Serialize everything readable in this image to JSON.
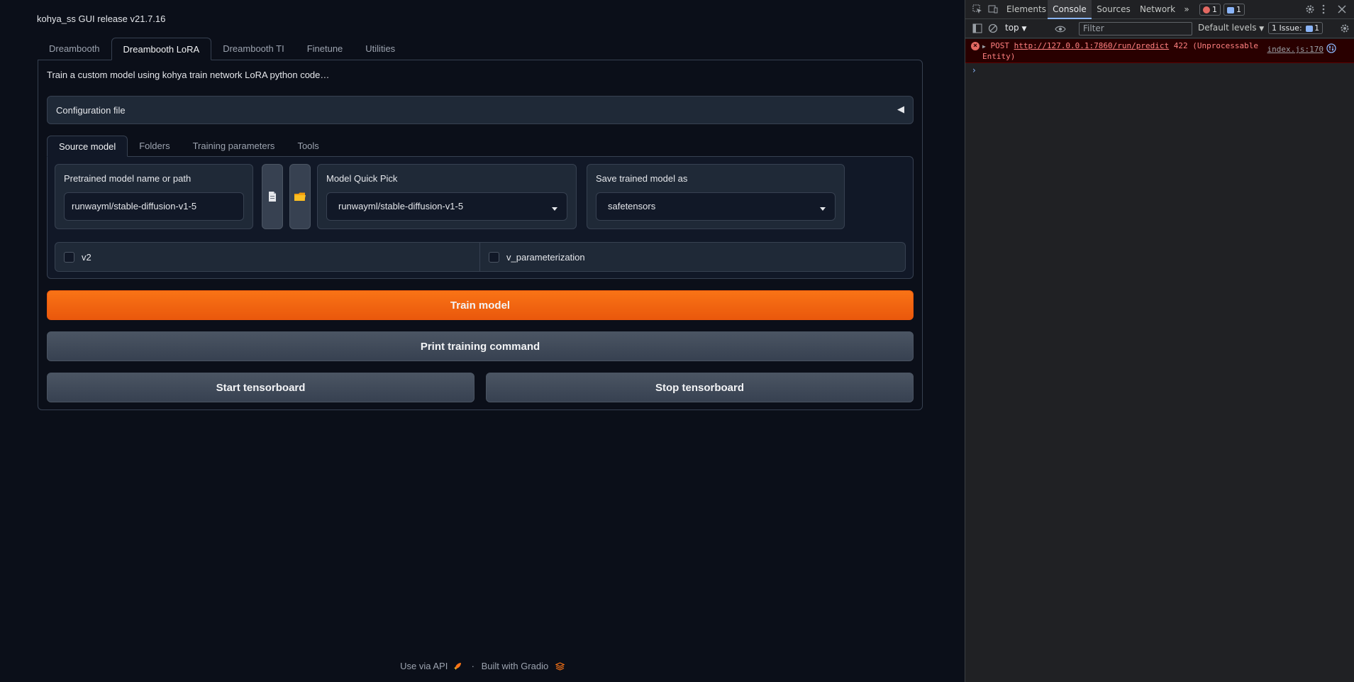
{
  "app": {
    "title": "kohya_ss GUI release v21.7.16",
    "tabs": [
      {
        "label": "Dreambooth"
      },
      {
        "label": "Dreambooth LoRA"
      },
      {
        "label": "Dreambooth TI"
      },
      {
        "label": "Finetune"
      },
      {
        "label": "Utilities"
      }
    ],
    "active_tab": "Dreambooth LoRA",
    "description": "Train a custom model using kohya train network LoRA python code…",
    "config_accordion": {
      "label": "Configuration file",
      "caret": "◀"
    },
    "subtabs": [
      {
        "label": "Source model"
      },
      {
        "label": "Folders"
      },
      {
        "label": "Training parameters"
      },
      {
        "label": "Tools"
      }
    ],
    "active_subtab": "Source model",
    "pretrained": {
      "label": "Pretrained model name or path",
      "value": "runwayml/stable-diffusion-v1-5"
    },
    "file_button_icon": "file-icon",
    "folder_button_icon": "folder-icon",
    "quick_pick": {
      "label": "Model Quick Pick",
      "value": "runwayml/stable-diffusion-v1-5"
    },
    "save_as": {
      "label": "Save trained model as",
      "value": "safetensors"
    },
    "checkboxes": [
      {
        "label": "v2",
        "checked": false
      },
      {
        "label": "v_parameterization",
        "checked": false
      }
    ],
    "buttons": {
      "train": "Train model",
      "print_command": "Print training command",
      "start_tensorboard": "Start tensorboard",
      "stop_tensorboard": "Stop tensorboard"
    },
    "footer": {
      "api": "Use via API",
      "separator": "·",
      "built": "Built with Gradio"
    },
    "colors": {
      "primary": "#f97316",
      "background": "#0b0f19"
    }
  },
  "devtools": {
    "tabs": [
      "Elements",
      "Console",
      "Sources",
      "Network"
    ],
    "active_tab": "Console",
    "more": "»",
    "error_badge": "1",
    "message_badge": "1",
    "context": "top",
    "filter_placeholder": "Filter",
    "levels": "Default levels",
    "issues": "1 Issue:",
    "issues_count": "1",
    "console": {
      "method": "POST",
      "url": "http://127.0.0.1:7860/run/predict",
      "status": "422 (Unprocessable Entity)",
      "source": "index.js:170"
    }
  }
}
